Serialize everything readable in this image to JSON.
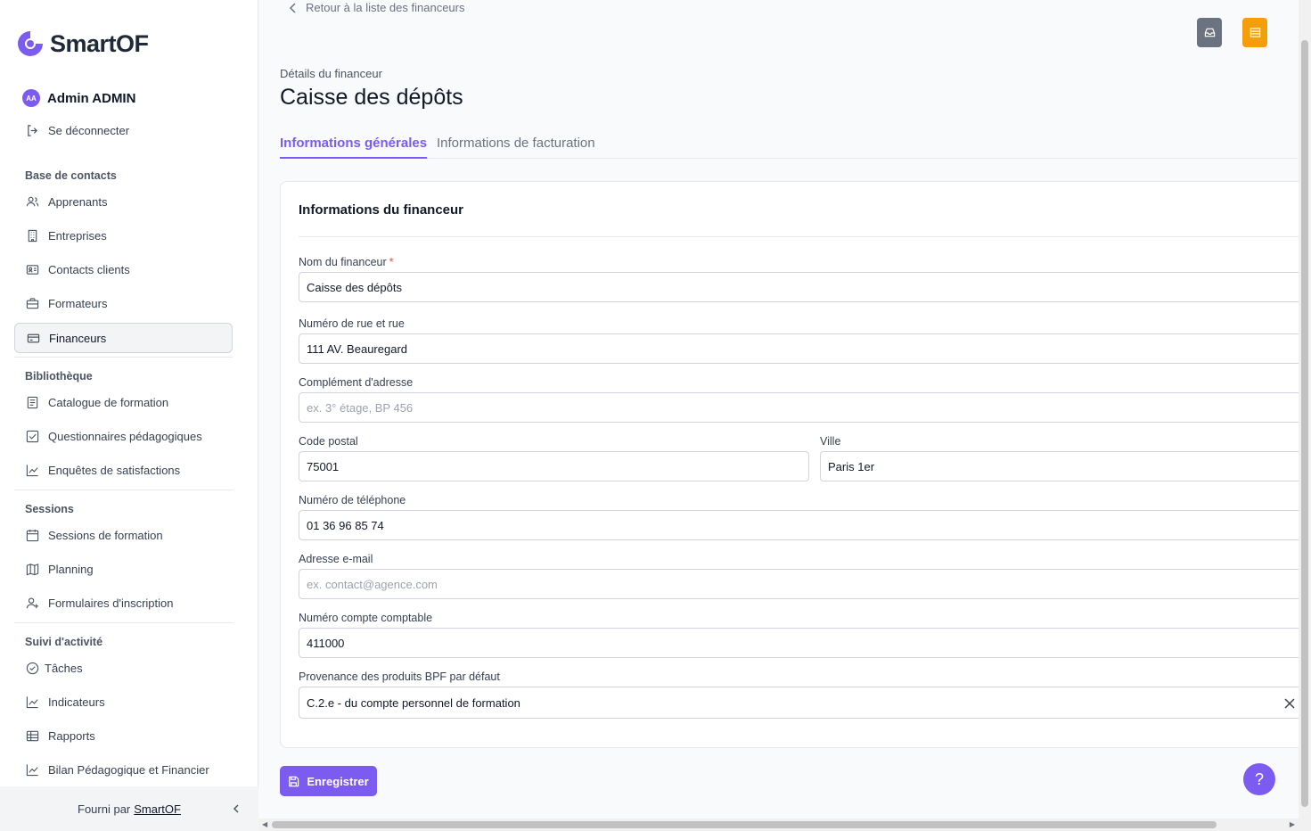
{
  "brand": {
    "name": "SmartOF",
    "accent": "#7c5cf0"
  },
  "user": {
    "initials": "AA",
    "name": "Admin ADMIN",
    "logout_label": "Se déconnecter"
  },
  "sidebar": {
    "sections": [
      {
        "title": "Base de contacts",
        "items": [
          {
            "label": "Apprenants",
            "icon": "users-icon"
          },
          {
            "label": "Entreprises",
            "icon": "building-icon"
          },
          {
            "label": "Contacts clients",
            "icon": "contact-card-icon"
          },
          {
            "label": "Formateurs",
            "icon": "briefcase-icon"
          },
          {
            "label": "Financeurs",
            "icon": "credit-card-icon",
            "active": true
          }
        ]
      },
      {
        "title": "Bibliothèque",
        "items": [
          {
            "label": "Catalogue de formation",
            "icon": "document-icon"
          },
          {
            "label": "Questionnaires pédagogiques",
            "icon": "checkbox-icon"
          },
          {
            "label": "Enquêtes de satisfactions",
            "icon": "chart-line-icon"
          }
        ]
      },
      {
        "title": "Sessions",
        "items": [
          {
            "label": "Sessions de formation",
            "icon": "calendar-icon"
          },
          {
            "label": "Planning",
            "icon": "map-icon"
          },
          {
            "label": "Formulaires d'inscription",
            "icon": "user-add-icon"
          }
        ]
      },
      {
        "title": "Suivi d'activité",
        "items": [
          {
            "label": "Tâches",
            "icon": "check-circle-icon"
          },
          {
            "label": "Indicateurs",
            "icon": "chart-line-icon"
          },
          {
            "label": "Rapports",
            "icon": "table-icon"
          },
          {
            "label": "Bilan Pédagogique et Financier",
            "icon": "chart-line-icon"
          }
        ]
      }
    ],
    "footer": {
      "prefix": "Fourni par",
      "link": "SmartOF"
    }
  },
  "header": {
    "back_link": "Retour à la liste des financeurs",
    "subtitle": "Détails du financeur",
    "title": "Caisse des dépôts"
  },
  "tabs": [
    {
      "label": "Informations générales",
      "active": true
    },
    {
      "label": "Informations de facturation",
      "active": false
    }
  ],
  "form": {
    "card_title": "Informations du financeur",
    "fields": {
      "nom": {
        "label": "Nom du financeur",
        "required": "*",
        "value": "Caisse des dépôts"
      },
      "rue": {
        "label": "Numéro de rue et rue",
        "value": "111 AV. Beauregard"
      },
      "complement": {
        "label": "Complément d'adresse",
        "placeholder": "ex. 3° étage, BP 456"
      },
      "cp": {
        "label": "Code postal",
        "value": "75001"
      },
      "ville": {
        "label": "Ville",
        "value": "Paris 1er"
      },
      "tel": {
        "label": "Numéro de téléphone",
        "value": "01 36 96 85 74"
      },
      "email": {
        "label": "Adresse e-mail",
        "placeholder": "ex. contact@agence.com"
      },
      "compte": {
        "label": "Numéro compte comptable",
        "value": "411000"
      },
      "bpf": {
        "label": "Provenance des produits BPF par défaut",
        "value": "C.2.e - du compte personnel de formation"
      }
    },
    "save_label": "Enregistrer"
  },
  "help_label": "?"
}
